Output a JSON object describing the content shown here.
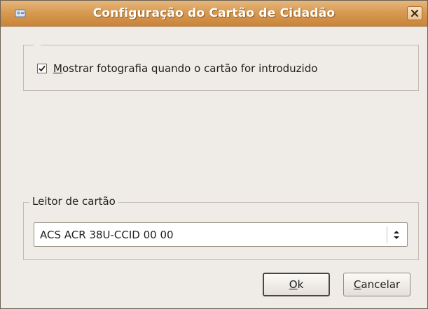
{
  "window": {
    "title": "Configuração do Cartão de Cidadão"
  },
  "photo_option": {
    "checked": true,
    "mnemonic": "M",
    "label_rest": "ostrar fotografia quando o cartão for introduzido"
  },
  "card_reader": {
    "group_label": "Leitor de cartão",
    "selected": "ACS ACR 38U-CCID 00 00"
  },
  "buttons": {
    "ok_mnemonic": "O",
    "ok_rest": "k",
    "cancel_mnemonic": "C",
    "cancel_rest": "ancelar"
  }
}
